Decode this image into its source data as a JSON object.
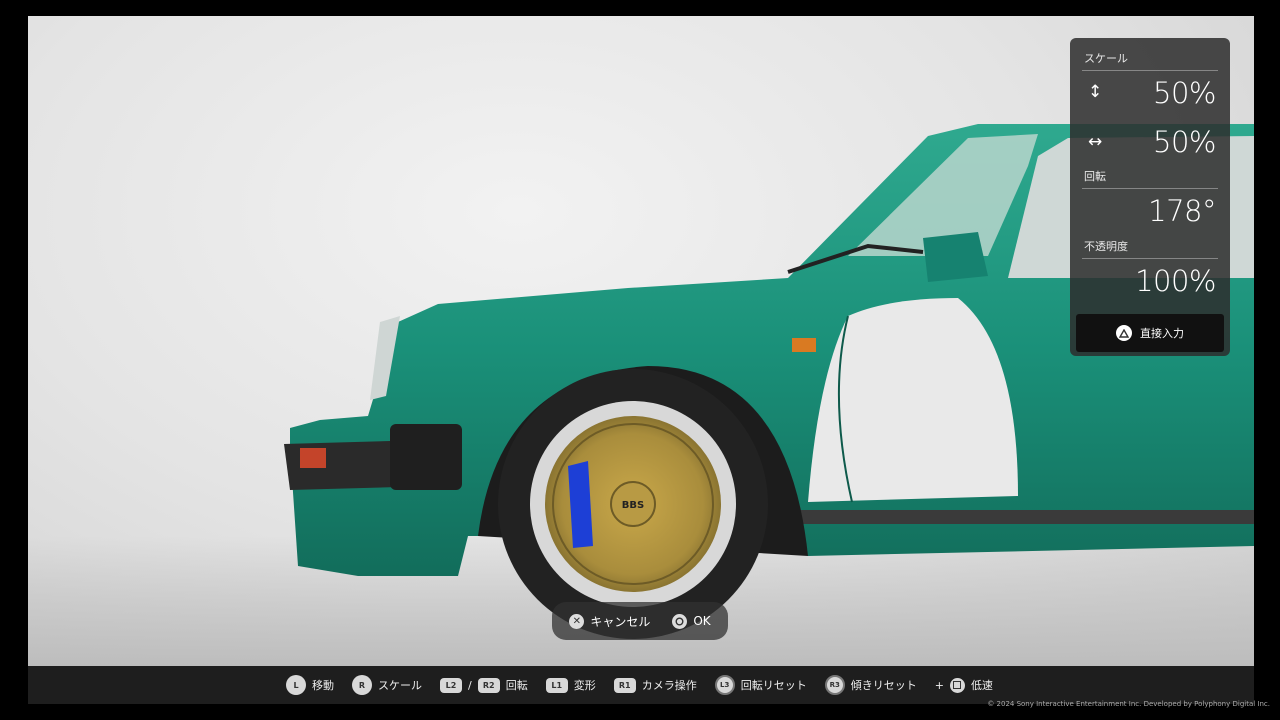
{
  "panel": {
    "scale_label": "スケール",
    "scale_vertical": "50%",
    "scale_horizontal": "50%",
    "rotation_label": "回転",
    "rotation_value": "178°",
    "opacity_label": "不透明度",
    "opacity_value": "100%",
    "direct_input_label": "直接入力"
  },
  "confirm": {
    "cancel_label": "キャンセル",
    "ok_label": "OK"
  },
  "hints": {
    "move_button": "L",
    "move_label": "移動",
    "scale_button": "R",
    "scale_label": "スケール",
    "rotate_button_1": "L2",
    "rotate_sep": "/",
    "rotate_button_2": "R2",
    "rotate_label": "回転",
    "transform_button": "L1",
    "transform_label": "変形",
    "camera_button": "R1",
    "camera_label": "カメラ操作",
    "rotate_reset_button": "L3",
    "rotate_reset_label": "回転リセット",
    "tilt_reset_button": "R3",
    "tilt_reset_label": "傾きリセット",
    "slow_plus": "+",
    "slow_label": "低速"
  },
  "wheel_badge": "BBS",
  "copyright": "© 2024 Sony Interactive Entertainment Inc. Developed by Polyphony Digital Inc.",
  "colors": {
    "car_body": "#1a9079",
    "panel_bg": "#2d2d2d",
    "decal": "#e9e9e9"
  }
}
